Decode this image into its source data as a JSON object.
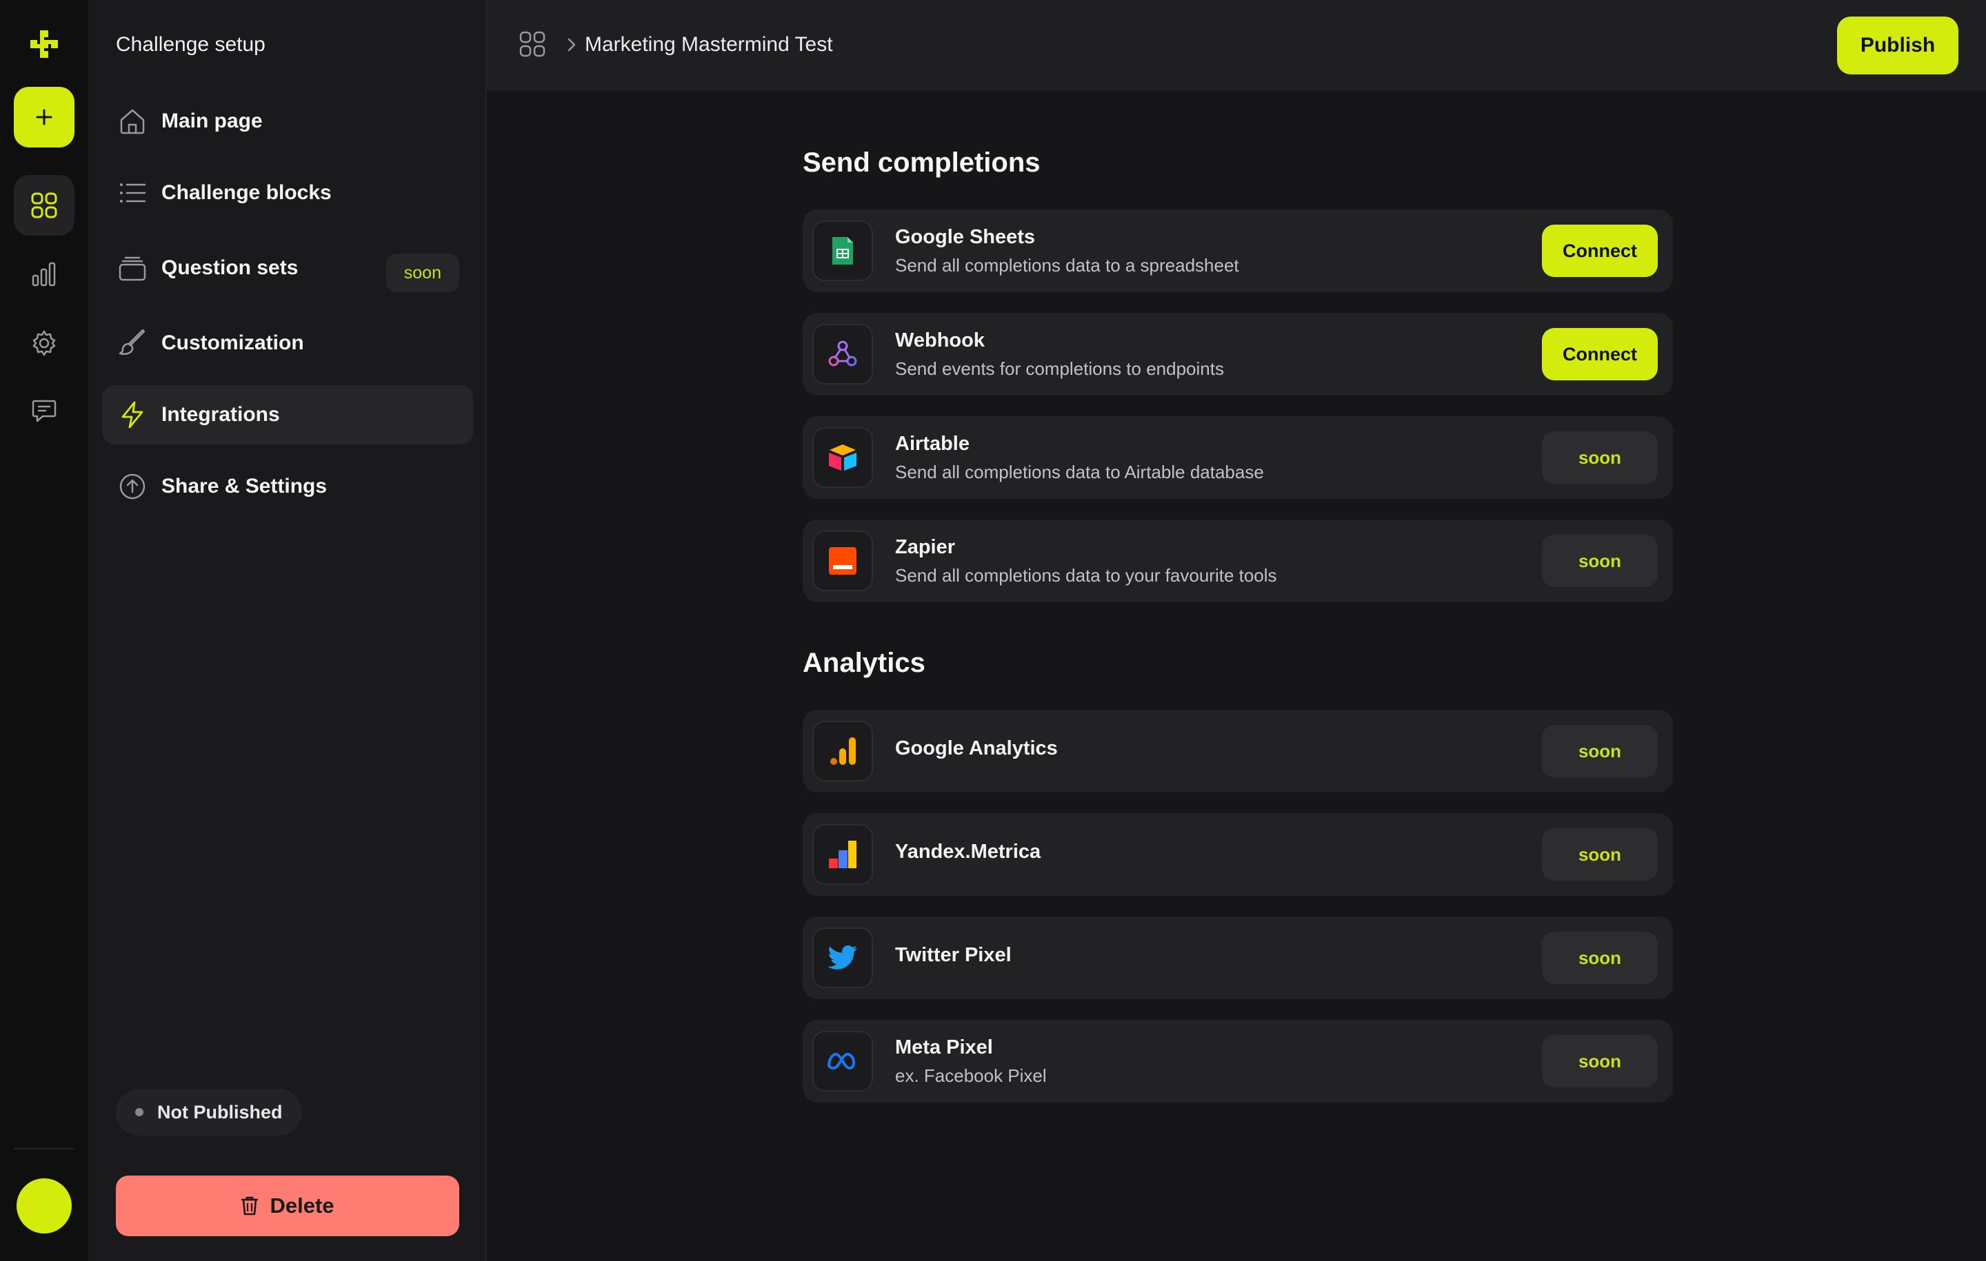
{
  "sidebar": {
    "title": "Challenge setup",
    "items": [
      {
        "label": "Main page"
      },
      {
        "label": "Challenge blocks"
      },
      {
        "label": "Question sets",
        "badge": "soon"
      },
      {
        "label": "Customization"
      },
      {
        "label": "Integrations",
        "active": true
      },
      {
        "label": "Share & Settings"
      }
    ],
    "status": "Not Published",
    "delete_label": "Delete"
  },
  "topbar": {
    "breadcrumb": "Marketing Mastermind Test",
    "publish_label": "Publish"
  },
  "sections": {
    "completions": {
      "title": "Send completions",
      "items": [
        {
          "name": "Google Sheets",
          "desc": "Send all completions data to a spreadsheet",
          "action": "Connect",
          "icon": "google-sheets-icon"
        },
        {
          "name": "Webhook",
          "desc": "Send events for completions to endpoints",
          "action": "Connect",
          "icon": "webhook-icon"
        },
        {
          "name": "Airtable",
          "desc": "Send all completions data to Airtable database",
          "action": "soon",
          "icon": "airtable-icon"
        },
        {
          "name": "Zapier",
          "desc": "Send all completions data to your favourite tools",
          "action": "soon",
          "icon": "zapier-icon"
        }
      ]
    },
    "analytics": {
      "title": "Analytics",
      "items": [
        {
          "name": "Google Analytics",
          "action": "soon",
          "icon": "google-analytics-icon"
        },
        {
          "name": "Yandex.Metrica",
          "action": "soon",
          "icon": "yandex-metrica-icon"
        },
        {
          "name": "Twitter Pixel",
          "action": "soon",
          "icon": "twitter-icon"
        },
        {
          "name": "Meta Pixel",
          "desc": "ex. Facebook Pixel",
          "action": "soon",
          "icon": "meta-icon"
        }
      ]
    }
  },
  "colors": {
    "accent": "#d4ec0c",
    "danger": "#fe7c72",
    "background": "#161618",
    "card": "#222224"
  }
}
